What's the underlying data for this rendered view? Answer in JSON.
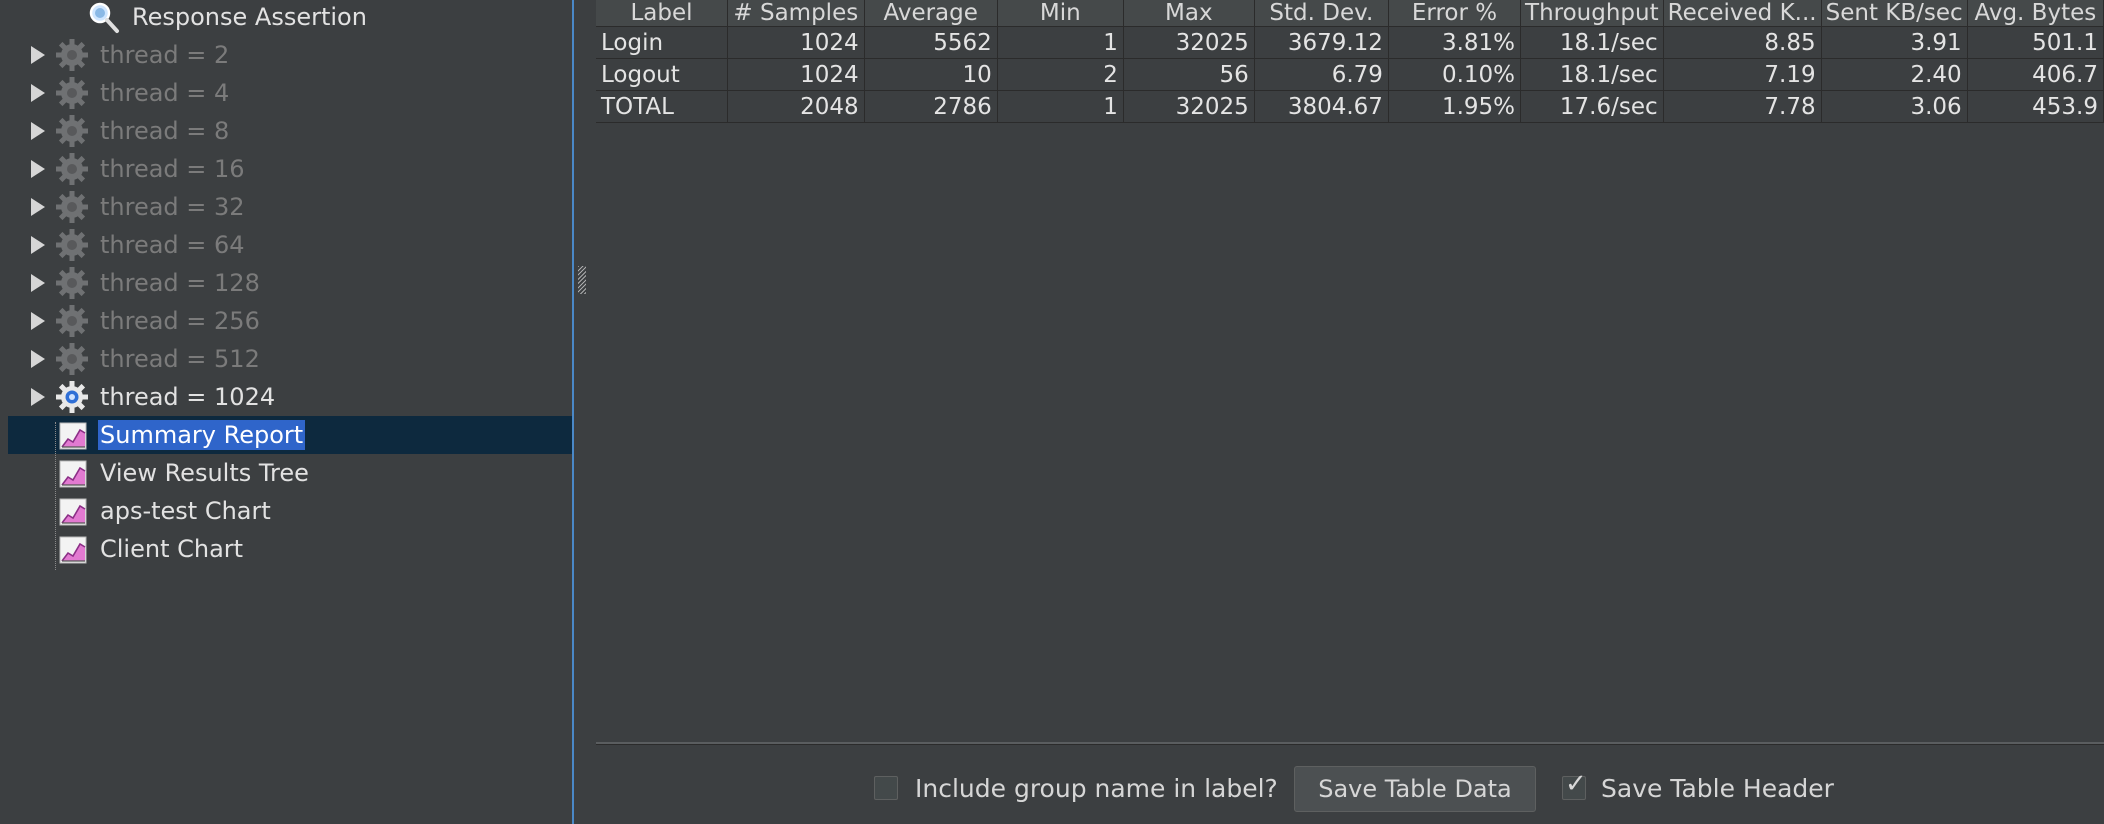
{
  "tree": {
    "response_assertion": "Response Assertion",
    "threads": [
      {
        "label": "thread = 2",
        "enabled": false
      },
      {
        "label": "thread = 4",
        "enabled": false
      },
      {
        "label": "thread = 8",
        "enabled": false
      },
      {
        "label": "thread = 16",
        "enabled": false
      },
      {
        "label": "thread = 32",
        "enabled": false
      },
      {
        "label": "thread = 64",
        "enabled": false
      },
      {
        "label": "thread = 128",
        "enabled": false
      },
      {
        "label": "thread = 256",
        "enabled": false
      },
      {
        "label": "thread = 512",
        "enabled": false
      },
      {
        "label": "thread = 1024",
        "enabled": true
      }
    ],
    "listeners": [
      {
        "label": "Summary Report",
        "selected": true
      },
      {
        "label": "View Results Tree",
        "selected": false
      },
      {
        "label": "aps-test Chart",
        "selected": false
      },
      {
        "label": "Client Chart",
        "selected": false
      }
    ]
  },
  "table": {
    "headers": [
      "Label",
      "# Samples",
      "Average",
      "Min",
      "Max",
      "Std. Dev.",
      "Error %",
      "Throughput",
      "Received K...",
      "Sent KB/sec",
      "Avg. Bytes"
    ],
    "rows": [
      [
        "Login",
        "1024",
        "5562",
        "1",
        "32025",
        "3679.12",
        "3.81%",
        "18.1/sec",
        "8.85",
        "3.91",
        "501.1"
      ],
      [
        "Logout",
        "1024",
        "10",
        "2",
        "56",
        "6.79",
        "0.10%",
        "18.1/sec",
        "7.19",
        "2.40",
        "406.7"
      ],
      [
        "TOTAL",
        "2048",
        "2786",
        "1",
        "32025",
        "3804.67",
        "1.95%",
        "17.6/sec",
        "7.78",
        "3.06",
        "453.9"
      ]
    ]
  },
  "bottom": {
    "include_group_label": "Include group name in label?",
    "include_group_checked": false,
    "save_table_data": "Save Table Data",
    "save_table_header": "Save Table Header",
    "save_table_header_checked": true
  },
  "colors": {
    "selection": "#2f65ca",
    "selected_row_bg": "#0d293e",
    "panel_bg": "#3c3f41"
  }
}
